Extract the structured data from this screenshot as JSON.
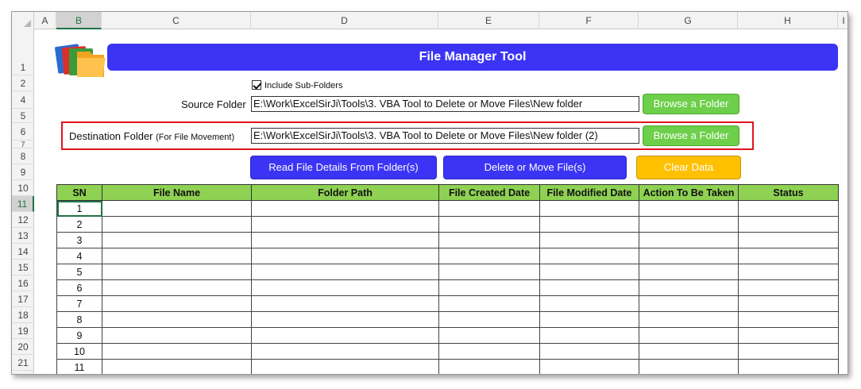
{
  "columns": [
    "A",
    "B",
    "C",
    "D",
    "E",
    "F",
    "G",
    "H",
    "I"
  ],
  "rows": [
    "1",
    "2",
    "4",
    "5",
    "6",
    "7",
    "8",
    "9",
    "10",
    "11",
    "12",
    "13",
    "14",
    "15",
    "16",
    "17",
    "18",
    "19",
    "20",
    "21"
  ],
  "selected_column": "B",
  "selected_row": "11",
  "tool_title": "File Manager Tool",
  "include_subfolders": {
    "label": "Include Sub-Folders",
    "checked": true
  },
  "source": {
    "label": "Source Folder",
    "path": "E:\\Work\\ExcelSirJi\\Tools\\3. VBA Tool to Delete or Move Files\\New folder",
    "browse_label": "Browse a Folder"
  },
  "destination": {
    "label": "Destination Folder",
    "sublabel": "(For File Movement)",
    "path": "E:\\Work\\ExcelSirJi\\Tools\\3. VBA Tool to Delete or Move Files\\New folder (2)",
    "browse_label": "Browse a Folder"
  },
  "actions": {
    "read_label": "Read File Details From Folder(s)",
    "delete_move_label": "Delete or Move File(s)",
    "clear_label": "Clear Data"
  },
  "table": {
    "headers": [
      "SN",
      "File Name",
      "Folder Path",
      "File Created Date",
      "File Modified Date",
      "Action To Be Taken",
      "Status"
    ],
    "serials": [
      "1",
      "2",
      "3",
      "4",
      "5",
      "6",
      "7",
      "8",
      "9",
      "10",
      "11"
    ]
  },
  "colors": {
    "banner": "#3b34f5",
    "header_green": "#8fd253",
    "browse_green": "#6dcf4a",
    "clear_yellow": "#ffc000",
    "highlight_red": "#e0141e",
    "excel_green": "#217346"
  }
}
